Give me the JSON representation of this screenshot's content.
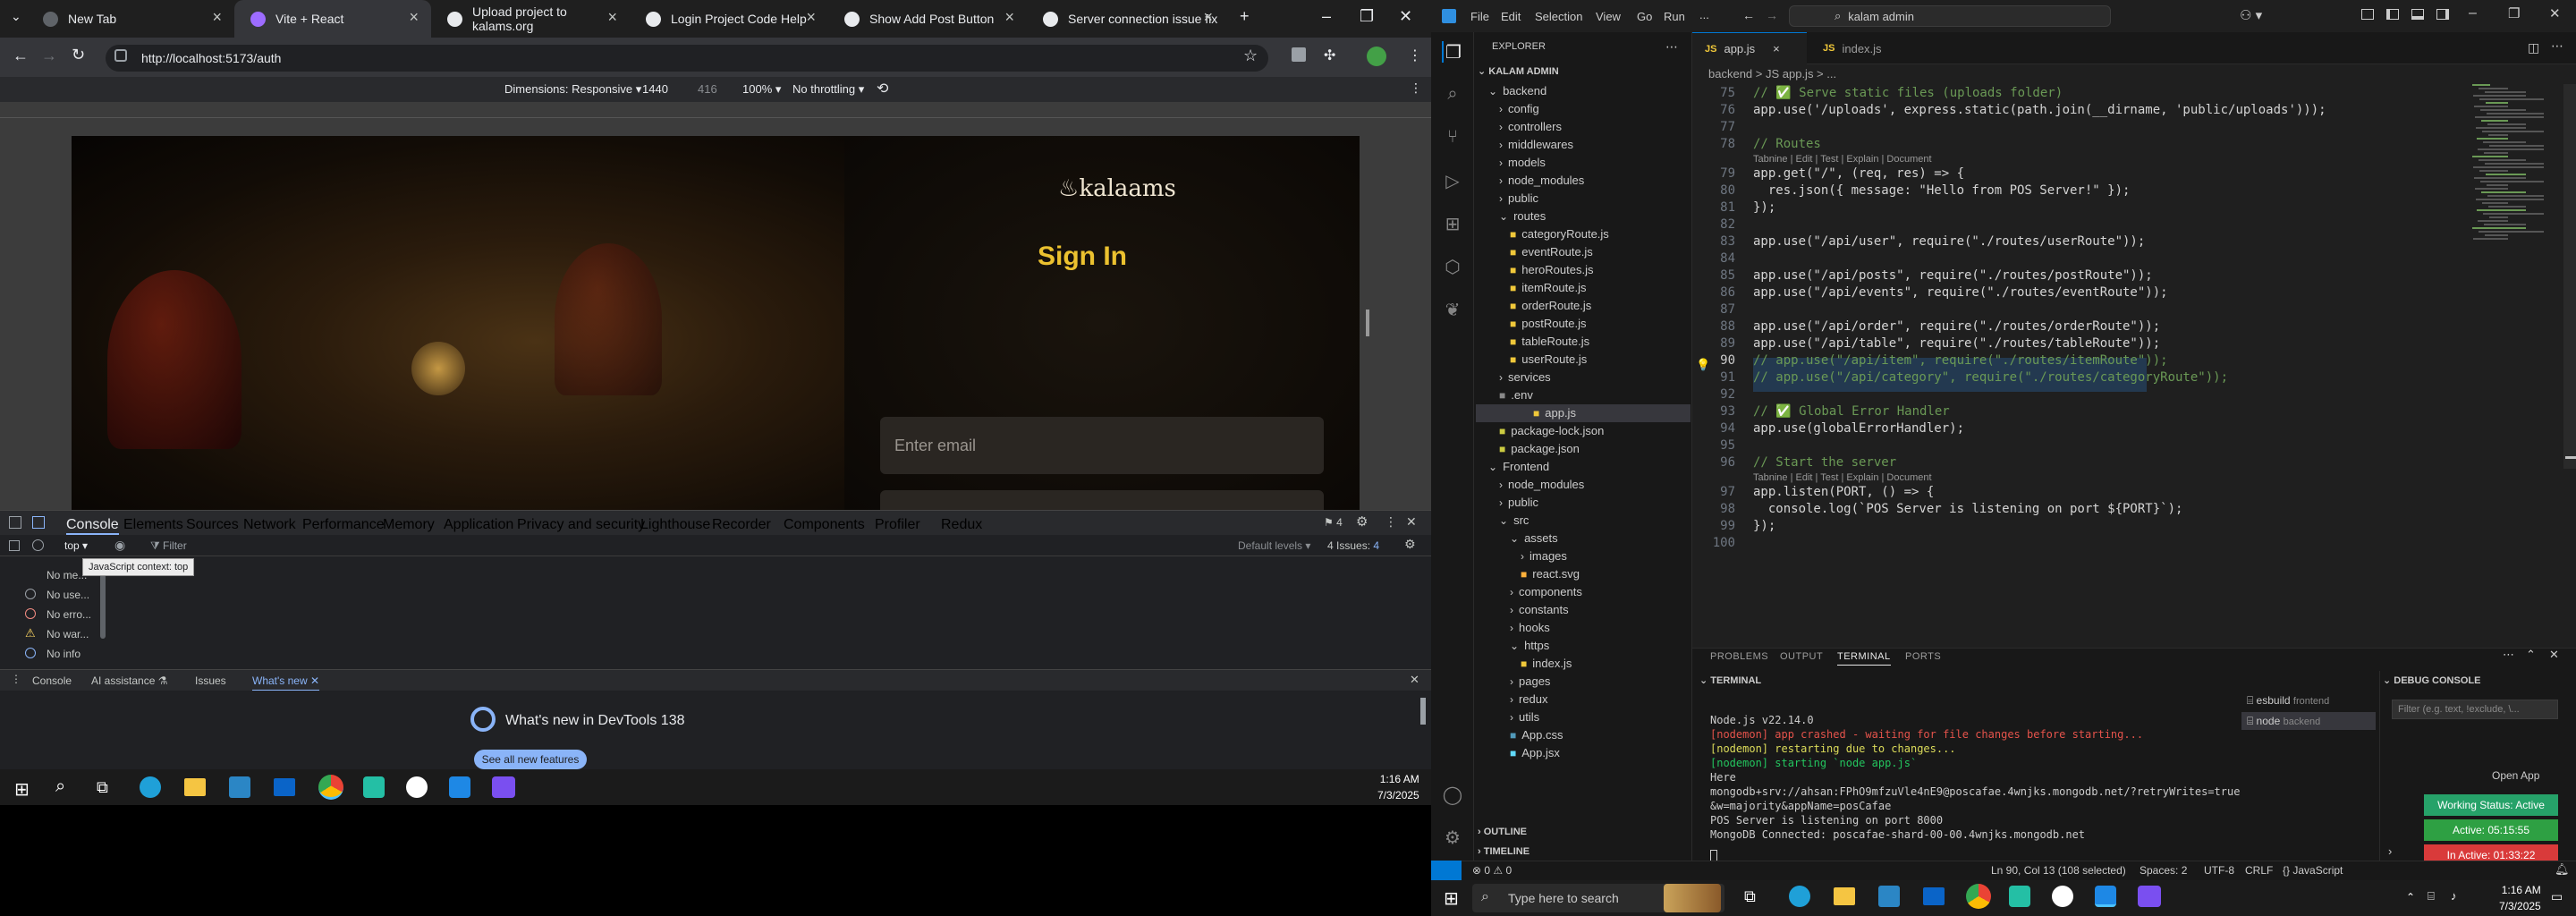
{
  "chrome": {
    "tabs": [
      {
        "label": "New Tab"
      },
      {
        "label": "Vite + React"
      },
      {
        "label": "Upload project to kalams.org"
      },
      {
        "label": "Login Project Code Help"
      },
      {
        "label": "Show Add Post Button"
      },
      {
        "label": "Server connection issue fix"
      }
    ],
    "url": "http://localhost:5173/auth",
    "device_toolbar": {
      "dimensions": "Dimensions: Responsive",
      "width": "1440",
      "height": "416",
      "zoom": "100%",
      "throttle": "No throttling"
    },
    "page": {
      "logo": "kalaams",
      "title": "Sign In",
      "email_placeholder": "Enter email"
    },
    "devtools": {
      "tabs": [
        "Console",
        "Elements",
        "Sources",
        "Network",
        "Performance",
        "Memory",
        "Application",
        "Privacy and security",
        "Lighthouse",
        "Recorder",
        "Components",
        "Profiler",
        "Redux"
      ],
      "context": "top",
      "filter_placeholder": "Filter",
      "levels": "Default levels",
      "issues_count": "4",
      "issues_label": "4 Issues:",
      "issues_badge": "4",
      "tooltip": "JavaScript context: top",
      "messages": [
        "No me...",
        "No use...",
        "No erro...",
        "No war...",
        "No info"
      ],
      "drawer_tabs": [
        "Console",
        "AI assistance",
        "Issues",
        "What's new"
      ],
      "whats_new_title": "What's new in DevTools 138",
      "whats_new_button": "See all new features"
    },
    "taskbar": {
      "time": "1:16 AM",
      "date": "7/3/2025"
    }
  },
  "vscode": {
    "menu": [
      "File",
      "Edit",
      "Selection",
      "View",
      "Go",
      "Run",
      "..."
    ],
    "search": "kalam admin",
    "explorer_title": "EXPLORER",
    "root": "KALAM ADMIN",
    "tree": [
      {
        "label": "backend",
        "indent": 1,
        "kind": "open"
      },
      {
        "label": "config",
        "indent": 2,
        "kind": "closed"
      },
      {
        "label": "controllers",
        "indent": 2,
        "kind": "closed"
      },
      {
        "label": "middlewares",
        "indent": 2,
        "kind": "closed"
      },
      {
        "label": "models",
        "indent": 2,
        "kind": "closed"
      },
      {
        "label": "node_modules",
        "indent": 2,
        "kind": "closed"
      },
      {
        "label": "public",
        "indent": 2,
        "kind": "closed"
      },
      {
        "label": "routes",
        "indent": 2,
        "kind": "open"
      },
      {
        "label": "categoryRoute.js",
        "indent": 3,
        "kind": "js"
      },
      {
        "label": "eventRoute.js",
        "indent": 3,
        "kind": "js"
      },
      {
        "label": "heroRoutes.js",
        "indent": 3,
        "kind": "js"
      },
      {
        "label": "itemRoute.js",
        "indent": 3,
        "kind": "js"
      },
      {
        "label": "orderRoute.js",
        "indent": 3,
        "kind": "js"
      },
      {
        "label": "postRoute.js",
        "indent": 3,
        "kind": "js"
      },
      {
        "label": "tableRoute.js",
        "indent": 3,
        "kind": "js"
      },
      {
        "label": "userRoute.js",
        "indent": 3,
        "kind": "js"
      },
      {
        "label": "services",
        "indent": 2,
        "kind": "closed"
      },
      {
        "label": ".env",
        "indent": 2,
        "kind": "file"
      },
      {
        "label": "app.js",
        "indent": 2,
        "kind": "js"
      },
      {
        "label": "package-lock.json",
        "indent": 2,
        "kind": "json"
      },
      {
        "label": "package.json",
        "indent": 2,
        "kind": "json"
      },
      {
        "label": "Frontend",
        "indent": 1,
        "kind": "open"
      },
      {
        "label": "node_modules",
        "indent": 2,
        "kind": "closed"
      },
      {
        "label": "public",
        "indent": 2,
        "kind": "closed"
      },
      {
        "label": "src",
        "indent": 2,
        "kind": "open"
      },
      {
        "label": "assets",
        "indent": 3,
        "kind": "open"
      },
      {
        "label": "images",
        "indent": 4,
        "kind": "closed"
      },
      {
        "label": "react.svg",
        "indent": 4,
        "kind": "svg"
      },
      {
        "label": "components",
        "indent": 3,
        "kind": "closed"
      },
      {
        "label": "constants",
        "indent": 3,
        "kind": "closed"
      },
      {
        "label": "hooks",
        "indent": 3,
        "kind": "closed"
      },
      {
        "label": "https",
        "indent": 3,
        "kind": "open"
      },
      {
        "label": "index.js",
        "indent": 4,
        "kind": "js"
      },
      {
        "label": "pages",
        "indent": 3,
        "kind": "closed"
      },
      {
        "label": "redux",
        "indent": 3,
        "kind": "closed"
      },
      {
        "label": "utils",
        "indent": 3,
        "kind": "closed"
      },
      {
        "label": "App.css",
        "indent": 3,
        "kind": "css"
      },
      {
        "label": "App.jsx",
        "indent": 3,
        "kind": "jsx"
      }
    ],
    "outline": "OUTLINE",
    "timeline": "TIMELINE",
    "editor_tabs": [
      "app.js",
      "index.js"
    ],
    "breadcrumb": "backend  >  JS app.js  >  ...",
    "code_lines": [
      {
        "n": "75",
        "t": "// ✅ Serve static files (uploads folder)",
        "c": "#6a9955"
      },
      {
        "n": "76",
        "t": "app.use('/uploads', express.static(path.join(__dirname, 'public/uploads')));",
        "c": "#d4d4d4"
      },
      {
        "n": "77",
        "t": "",
        "c": "#d4d4d4"
      },
      {
        "n": "78",
        "t": "// Routes",
        "c": "#6a9955"
      },
      {
        "n": "79",
        "t": "app.get(\"/\", (req, res) => {",
        "c": "#d4d4d4"
      },
      {
        "n": "80",
        "t": "  res.json({ message: \"Hello from POS Server!\" });",
        "c": "#d4d4d4"
      },
      {
        "n": "81",
        "t": "});",
        "c": "#d4d4d4"
      },
      {
        "n": "82",
        "t": "",
        "c": "#d4d4d4"
      },
      {
        "n": "83",
        "t": "app.use(\"/api/user\", require(\"./routes/userRoute\"));",
        "c": "#d4d4d4"
      },
      {
        "n": "84",
        "t": "",
        "c": "#d4d4d4"
      },
      {
        "n": "85",
        "t": "app.use(\"/api/posts\", require(\"./routes/postRoute\"));",
        "c": "#d4d4d4"
      },
      {
        "n": "86",
        "t": "app.use(\"/api/events\", require(\"./routes/eventRoute\"));",
        "c": "#d4d4d4"
      },
      {
        "n": "87",
        "t": "",
        "c": "#d4d4d4"
      },
      {
        "n": "88",
        "t": "app.use(\"/api/order\", require(\"./routes/orderRoute\"));",
        "c": "#d4d4d4"
      },
      {
        "n": "89",
        "t": "app.use(\"/api/table\", require(\"./routes/tableRoute\"));",
        "c": "#d4d4d4"
      },
      {
        "n": "90",
        "t": "// app.use(\"/api/item\", require(\"./routes/itemRoute\"));",
        "c": "#6a9955"
      },
      {
        "n": "91",
        "t": "// app.use(\"/api/category\", require(\"./routes/categoryRoute\"));",
        "c": "#6a9955"
      },
      {
        "n": "92",
        "t": "",
        "c": "#d4d4d4"
      },
      {
        "n": "93",
        "t": "// ✅ Global Error Handler",
        "c": "#6a9955"
      },
      {
        "n": "94",
        "t": "app.use(globalErrorHandler);",
        "c": "#d4d4d4"
      },
      {
        "n": "95",
        "t": "",
        "c": "#d4d4d4"
      },
      {
        "n": "96",
        "t": "// Start the server",
        "c": "#6a9955"
      },
      {
        "n": "97",
        "t": "app.listen(PORT, () => {",
        "c": "#d4d4d4"
      },
      {
        "n": "98",
        "t": "  console.log(`POS Server is listening on port ${PORT}`);",
        "c": "#d4d4d4"
      },
      {
        "n": "99",
        "t": "});",
        "c": "#d4d4d4"
      },
      {
        "n": "100",
        "t": "",
        "c": "#d4d4d4"
      }
    ],
    "codelens": "Tabnine | Edit | Test | Explain | Document",
    "panel_tabs": [
      "PROBLEMS",
      "OUTPUT",
      "TERMINAL",
      "PORTS"
    ],
    "terminal_title": "TERMINAL",
    "terminal_lines": [
      {
        "t": "Node.js v22.14.0",
        "c": "#cccccc"
      },
      {
        "t": "[nodemon] app crashed - waiting for file changes before starting...",
        "c": "#e5534b"
      },
      {
        "t": "[nodemon] restarting due to changes...",
        "c": "#dcdc5a"
      },
      {
        "t": "[nodemon] starting `node app.js`",
        "c": "#23c55e"
      },
      {
        "t": "Here",
        "c": "#cccccc"
      },
      {
        "t": "mongodb+srv://ahsan:FPhO9mfzuVle4nE9@poscafae.4wnjks.mongodb.net/?retryWrites=true",
        "c": "#cccccc"
      },
      {
        "t": "&w=majority&appName=posCafae",
        "c": "#cccccc"
      },
      {
        "t": "POS Server is listening on port 8000",
        "c": "#cccccc"
      },
      {
        "t": "MongoDB Connected: poscafae-shard-00-00.4wnjks.mongodb.net",
        "c": "#cccccc"
      }
    ],
    "terminal_sessions": [
      {
        "name": "esbuild",
        "folder": "frontend"
      },
      {
        "name": "node",
        "folder": "backend"
      }
    ],
    "debug_title": "DEBUG CONSOLE",
    "debug_filter": "Filter (e.g. text, !exclude, \\...",
    "open_app": "Open App",
    "wakatime": [
      "Working Status: Active",
      "Active: 05:15:55",
      "In Active: 01:33:22"
    ],
    "status": {
      "errors": "0",
      "warnings": "0",
      "position": "Ln 90, Col 13 (108 selected)",
      "spaces": "Spaces: 2",
      "encoding": "UTF-8",
      "eol": "CRLF",
      "lang": "JavaScript"
    },
    "taskbar": {
      "search": "Type here to search",
      "time": "1:16 AM",
      "date": "7/3/2025"
    }
  }
}
